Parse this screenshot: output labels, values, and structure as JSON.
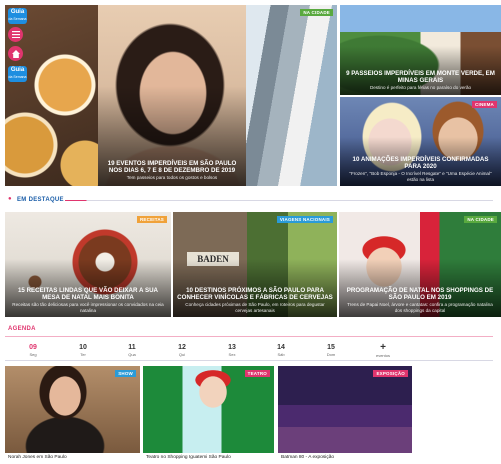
{
  "brand": {
    "logo_line1": "Guia",
    "logo_line2": "da Semana"
  },
  "hero": {
    "main": {
      "title": "19 eventos imperdíveis em São Paulo nos dias 6, 7 e 8 de dezembro de 2019",
      "subtitle": "Tem passeios para todos os gostos e bolsos"
    },
    "top_right_a": {
      "tag": "Na cidade"
    },
    "top_right_b": {
      "title": "9 passeios imperdíveis em Monte Verde, em Minas Gerais",
      "subtitle": "Destino é perfeito para férias no paraíso do verão"
    },
    "bottom_right": {
      "tag": "Cinema",
      "title": "10 animações imperdíveis confirmadas para 2020",
      "subtitle": "\"Frozen\", \"Bob Esponja - O Incrível Resgate\" e \"Uma Espécie Animal\" estão na lista"
    }
  },
  "em_destaque": {
    "heading": "EM DESTAQUE",
    "cards": [
      {
        "tag": "Receitas",
        "title": "15 receitas lindas que vão deixar a sua mesa de Natal mais bonita",
        "subtitle": "Receitas são tão deliciosas para você impressionar os convidados na ceia natalina"
      },
      {
        "tag": "Viagens nacionais",
        "title": "10 destinos próximos a São Paulo para conhecer vinícolas e fábricas de cervejas",
        "subtitle": "Conheça cidades próximas de São Paulo, em roteiros para degustar cervejas artesanais",
        "sign": "BADEN"
      },
      {
        "tag": "Na cidade",
        "title": "Programação de Natal nos shoppings de São Paulo em 2019",
        "subtitle": "Trens de Papai Noel, árvore e cantatas: confira a programação natalina dos shoppings da capital"
      }
    ]
  },
  "agenda": {
    "heading": "AGENDA",
    "days": [
      {
        "num": "09",
        "label": "Seg"
      },
      {
        "num": "10",
        "label": "Ter"
      },
      {
        "num": "11",
        "label": "Qua"
      },
      {
        "num": "12",
        "label": "Qui"
      },
      {
        "num": "13",
        "label": "Sex"
      },
      {
        "num": "14",
        "label": "Sáb"
      },
      {
        "num": "15",
        "label": "Dom"
      }
    ],
    "more": {
      "symbol": "+",
      "label": "eventos"
    },
    "events": [
      {
        "tag": "Show",
        "caption": "Norah Jones em São Paulo"
      },
      {
        "tag": "Teatro",
        "caption": "Teatro no Shopping Iguatemi São Paulo"
      },
      {
        "tag": "Exposição",
        "caption": "Batman 80 - A exposição"
      }
    ]
  }
}
